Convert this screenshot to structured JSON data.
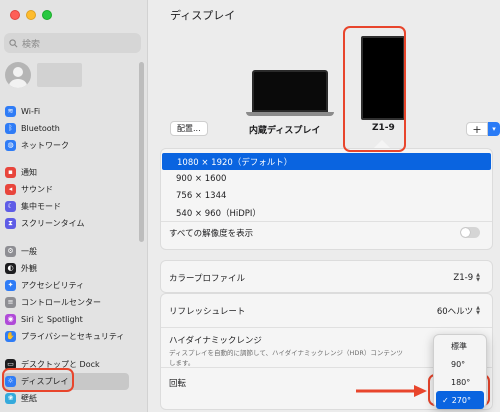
{
  "window": {
    "title": "ディスプレイ"
  },
  "sidebar": {
    "search_placeholder": "検索",
    "items": [
      {
        "label": "Wi-Fi",
        "icon": "wifi-icon",
        "color": "#2f7cf6",
        "glyph": "≋"
      },
      {
        "label": "Bluetooth",
        "icon": "bluetooth-icon",
        "color": "#2f7cf6",
        "glyph": "ᛒ"
      },
      {
        "label": "ネットワーク",
        "icon": "globe-icon",
        "color": "#2f7cf6",
        "glyph": "◍"
      },
      {
        "label": "通知",
        "icon": "bell-icon",
        "color": "#e8453c",
        "glyph": "▪"
      },
      {
        "label": "サウンド",
        "icon": "speaker-icon",
        "color": "#e8453c",
        "glyph": "◂"
      },
      {
        "label": "集中モード",
        "icon": "moon-icon",
        "color": "#5e5ce6",
        "glyph": "☾"
      },
      {
        "label": "スクリーンタイム",
        "icon": "hourglass-icon",
        "color": "#5e5ce6",
        "glyph": "⧗"
      },
      {
        "label": "一般",
        "icon": "gear-icon",
        "color": "#8e8e93",
        "glyph": "⚙"
      },
      {
        "label": "外観",
        "icon": "appearance-icon",
        "color": "#1d1d1f",
        "glyph": "◐"
      },
      {
        "label": "アクセシビリティ",
        "icon": "accessibility-icon",
        "color": "#2f7cf6",
        "glyph": "✦"
      },
      {
        "label": "コントロールセンター",
        "icon": "control-center-icon",
        "color": "#8e8e93",
        "glyph": "≡"
      },
      {
        "label": "Siri と Spotlight",
        "icon": "siri-icon",
        "color": "#b04ad8",
        "glyph": "◉"
      },
      {
        "label": "プライバシーとセキュリティ",
        "icon": "hand-icon",
        "color": "#2f7cf6",
        "glyph": "✋"
      },
      {
        "label": "デスクトップと Dock",
        "icon": "dock-icon",
        "color": "#1d1d1f",
        "glyph": "▭"
      },
      {
        "label": "ディスプレイ",
        "icon": "display-icon",
        "color": "#2f7cf6",
        "glyph": "☼"
      },
      {
        "label": "壁紙",
        "icon": "wallpaper-icon",
        "color": "#35aadc",
        "glyph": "❀"
      }
    ]
  },
  "displays": {
    "arrange_label": "配置...",
    "builtin_label": "内蔵ディスプレイ",
    "external_label": "Z1-9",
    "add_label": "+"
  },
  "resolutions": [
    {
      "label": "1080 × 1920（デフォルト）",
      "selected": true
    },
    {
      "label": "900 × 1600",
      "selected": false
    },
    {
      "label": "756 × 1344",
      "selected": false
    },
    {
      "label": "540 × 960（HiDPI）",
      "selected": false
    }
  ],
  "show_all_label": "すべての解像度を表示",
  "color_profile": {
    "label": "カラープロファイル",
    "value": "Z1-9"
  },
  "refresh_rate": {
    "label": "リフレッシュレート",
    "value": "60ヘルツ"
  },
  "hdr": {
    "title": "ハイダイナミックレンジ",
    "description": "ディスプレイを自動的に調節して、ハイダイナミックレンジ（HDR）コンテンツ",
    "description_2": "します。"
  },
  "rotation": {
    "label": "回転",
    "options": [
      "標準",
      "90°",
      "180°",
      "270°"
    ],
    "selected": "270°"
  },
  "colors": {
    "accent": "#0a64e0",
    "annotation": "#e8452c"
  }
}
